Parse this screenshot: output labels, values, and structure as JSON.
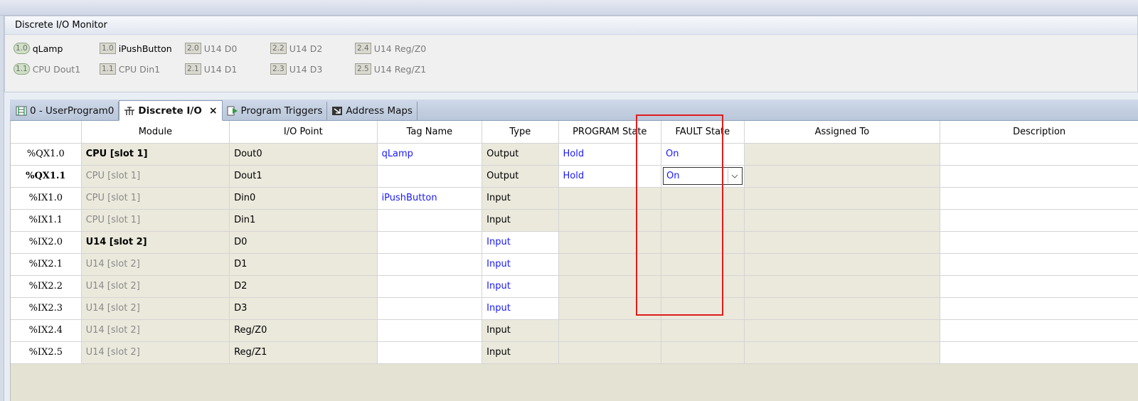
{
  "monitor": {
    "title": "Discrete I/O Monitor",
    "items": [
      {
        "badge": "1.0",
        "label": "qLamp"
      },
      {
        "badge": "1.1",
        "label": "CPU Dout1"
      },
      {
        "badge": "1.0",
        "label": "iPushButton"
      },
      {
        "badge": "1.1",
        "label": "CPU Din1"
      },
      {
        "badge": "2.0",
        "label": "U14 D0"
      },
      {
        "badge": "2.1",
        "label": "U14 D1"
      },
      {
        "badge": "2.2",
        "label": "U14 D2"
      },
      {
        "badge": "2.3",
        "label": "U14 D3"
      },
      {
        "badge": "2.4",
        "label": "U14 Reg/Z0"
      },
      {
        "badge": "2.5",
        "label": "U14 Reg/Z1"
      }
    ]
  },
  "tabs": [
    {
      "label": "0 - UserProgram0"
    },
    {
      "label": "Discrete I/O",
      "close": "×"
    },
    {
      "label": "Program Triggers"
    },
    {
      "label": "Address Maps"
    }
  ],
  "grid": {
    "headers": [
      "",
      "Module",
      "I/O Point",
      "Tag Name",
      "Type",
      "PROGRAM State",
      "FAULT State",
      "Assigned To",
      "Description"
    ],
    "rows": [
      {
        "addr": "%QX1.0",
        "module": "CPU [slot 1]",
        "point": "Dout0",
        "tag": "qLamp",
        "type": "Output",
        "program": "Hold",
        "fault": "On",
        "assigned": "",
        "desc": ""
      },
      {
        "addr": "%QX1.1",
        "module": "CPU [slot 1]",
        "point": "Dout1",
        "tag": "",
        "type": "Output",
        "program": "Hold",
        "fault": "On",
        "assigned": "",
        "desc": ""
      },
      {
        "addr": "%IX1.0",
        "module": "CPU [slot 1]",
        "point": "Din0",
        "tag": "iPushButton",
        "type": "Input",
        "program": "",
        "fault": "",
        "assigned": "",
        "desc": ""
      },
      {
        "addr": "%IX1.1",
        "module": "CPU [slot 1]",
        "point": "Din1",
        "tag": "",
        "type": "Input",
        "program": "",
        "fault": "",
        "assigned": "",
        "desc": ""
      },
      {
        "addr": "%IX2.0",
        "module": "U14 [slot 2]",
        "point": "D0",
        "tag": "",
        "type": "Input",
        "program": "",
        "fault": "",
        "assigned": "",
        "desc": ""
      },
      {
        "addr": "%IX2.1",
        "module": "U14 [slot 2]",
        "point": "D1",
        "tag": "",
        "type": "Input",
        "program": "",
        "fault": "",
        "assigned": "",
        "desc": ""
      },
      {
        "addr": "%IX2.2",
        "module": "U14 [slot 2]",
        "point": "D2",
        "tag": "",
        "type": "Input",
        "program": "",
        "fault": "",
        "assigned": "",
        "desc": ""
      },
      {
        "addr": "%IX2.3",
        "module": "U14 [slot 2]",
        "point": "D3",
        "tag": "",
        "type": "Input",
        "program": "",
        "fault": "",
        "assigned": "",
        "desc": ""
      },
      {
        "addr": "%IX2.4",
        "module": "U14 [slot 2]",
        "point": "Reg/Z0",
        "tag": "",
        "type": "Input",
        "program": "",
        "fault": "",
        "assigned": "",
        "desc": ""
      },
      {
        "addr": "%IX2.5",
        "module": "U14 [slot 2]",
        "point": "Reg/Z1",
        "tag": "",
        "type": "Input",
        "program": "",
        "fault": "",
        "assigned": "",
        "desc": ""
      }
    ]
  },
  "colors": {
    "highlight": "#e01c1c",
    "value_blue": "#1a1aff",
    "grid_bg": "#ebe9dc"
  }
}
